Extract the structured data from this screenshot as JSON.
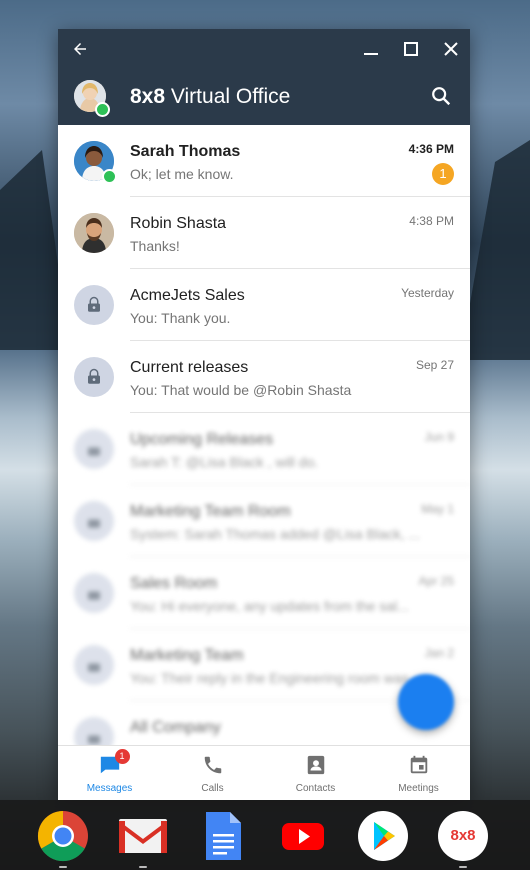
{
  "window": {
    "back_icon": "arrow-left-icon",
    "minimize_icon": "minimize-icon",
    "maximize_icon": "maximize-icon",
    "close_icon": "close-icon"
  },
  "header": {
    "brand": "8x8",
    "title": "Virtual Office",
    "search_icon": "search-icon"
  },
  "conversations": [
    {
      "name": "Sarah Thomas",
      "preview": "Ok; let me know.",
      "time": "4:36 PM",
      "unread": "1"
    },
    {
      "name": "Robin Shasta",
      "preview": "Thanks!",
      "time": "4:38 PM"
    },
    {
      "name": "AcmeJets Sales",
      "preview": "You: Thank you.",
      "time": "Yesterday"
    },
    {
      "name": "Current releases",
      "preview": "You: That would be @Robin Shasta",
      "time": "Sep 27"
    },
    {
      "name": "Upcoming Releases",
      "preview": "Sarah T: @Lisa Black , will do.",
      "time": "Jun 9"
    },
    {
      "name": "Marketing Team Room",
      "preview": "System: Sarah Thomas added @Lisa Black, ...",
      "time": "May 1"
    },
    {
      "name": "Sales Room",
      "preview": "You: Hi everyone, any updates from the sal...",
      "time": "Apr 25"
    },
    {
      "name": "Marketing Team",
      "preview": "You: Their reply in the Engineering room was...",
      "time": "Jan 2"
    },
    {
      "name": "All Company",
      "preview": "",
      "time": ""
    }
  ],
  "nav": [
    {
      "label": "Messages",
      "icon": "message-icon",
      "badge": "1"
    },
    {
      "label": "Calls",
      "icon": "phone-icon"
    },
    {
      "label": "Contacts",
      "icon": "contact-icon"
    },
    {
      "label": "Meetings",
      "icon": "calendar-icon"
    }
  ],
  "shelf": [
    {
      "icon": "chrome-icon"
    },
    {
      "icon": "gmail-icon"
    },
    {
      "icon": "docs-icon"
    },
    {
      "icon": "youtube-icon"
    },
    {
      "icon": "play-store-icon"
    },
    {
      "icon": "8x8-icon",
      "label": "8x8"
    }
  ],
  "colors": {
    "header_bg": "#2b3a4a",
    "accent": "#1e88e5",
    "unread_badge": "#f5a623",
    "presence": "#2ec157",
    "fab": "#1b7ff0"
  }
}
